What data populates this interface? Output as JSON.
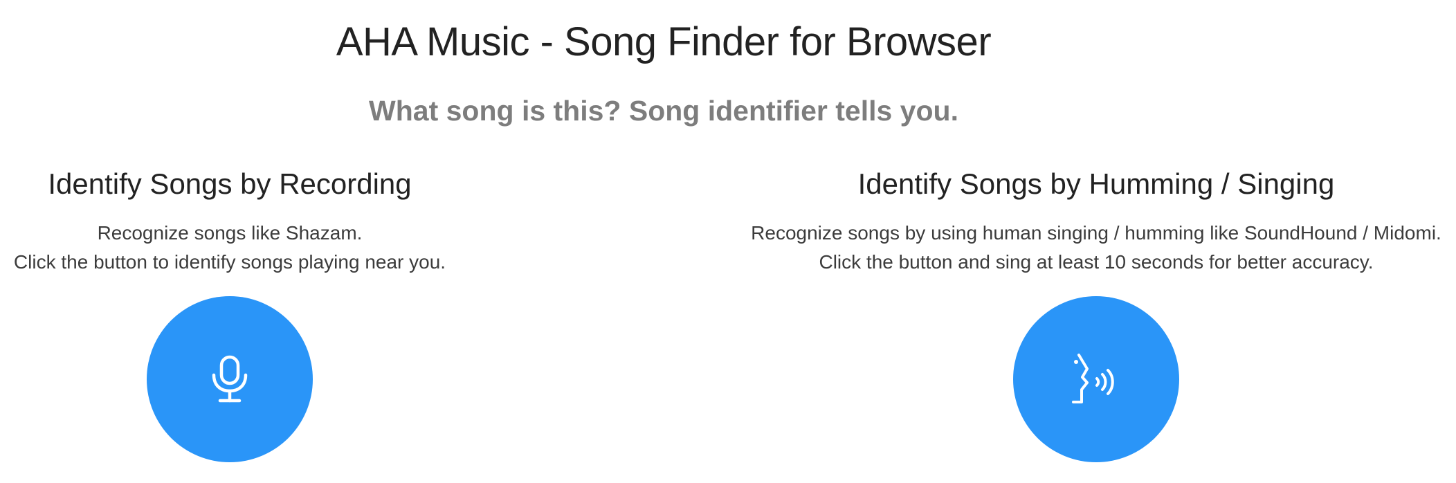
{
  "header": {
    "title": "AHA Music - Song Finder for Browser",
    "subtitle": "What song is this? Song identifier tells you."
  },
  "recording": {
    "heading": "Identify Songs by Recording",
    "desc_line1": "Recognize songs like Shazam.",
    "desc_line2": "Click the button to identify songs playing near you.",
    "button_icon": "microphone-icon"
  },
  "humming": {
    "heading": "Identify Songs by Humming / Singing",
    "desc_line1": "Recognize songs by using human singing / humming like SoundHound / Midomi.",
    "desc_line2": "Click the button and sing at least 10 seconds for better accuracy.",
    "button_icon": "singing-head-icon"
  },
  "colors": {
    "accent": "#2a95f8",
    "title": "#222222",
    "subtitle": "#7d7d7d",
    "body_text": "#3c3c3c"
  }
}
